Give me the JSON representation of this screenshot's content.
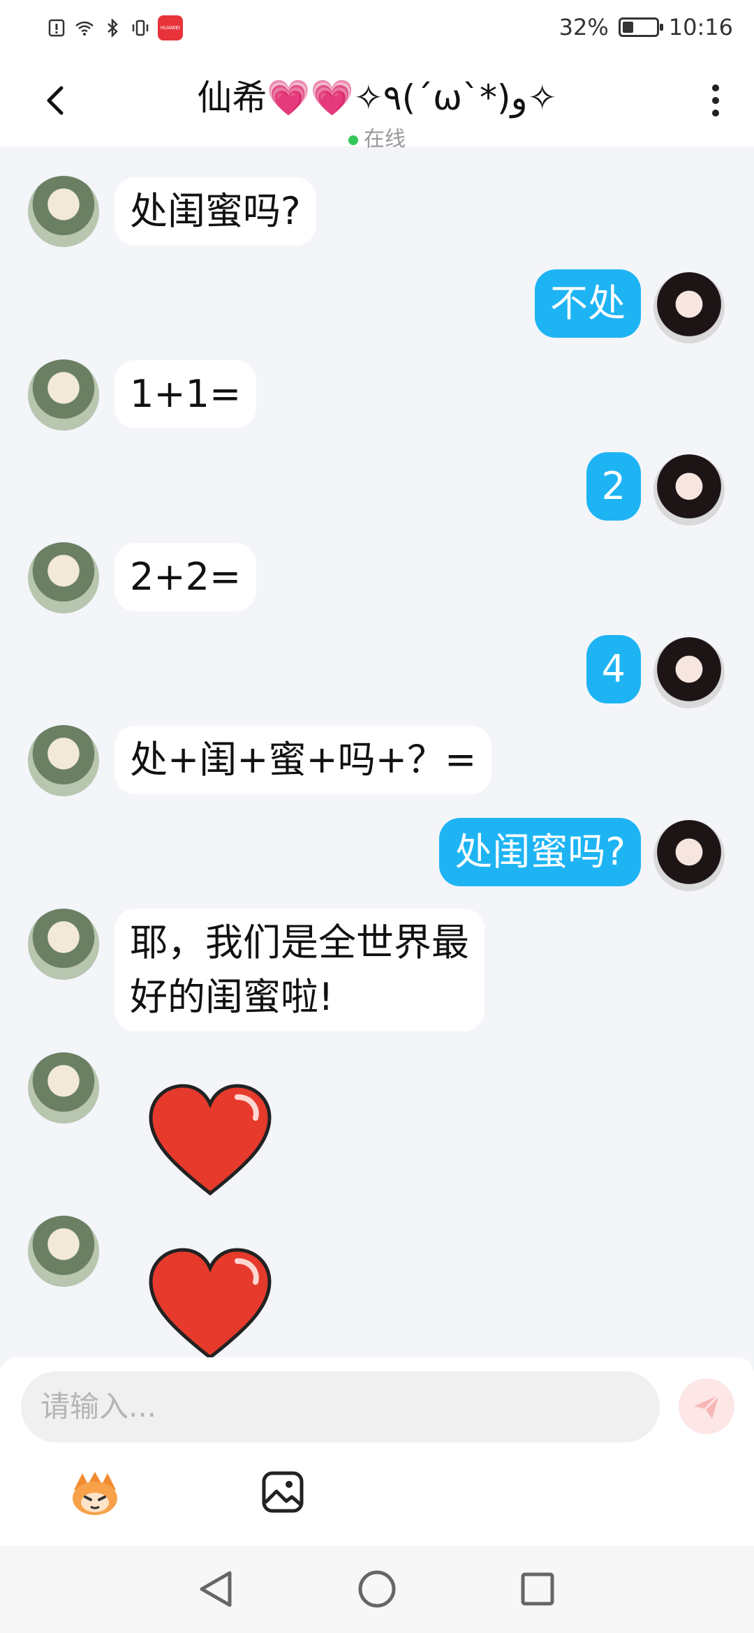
{
  "status_bar": {
    "battery": "32%",
    "battery_level": 0.32,
    "time": "10:16",
    "brand_badge": "HUAWEI"
  },
  "header": {
    "title": "仙希💗💗✧٩(ˊωˋ*)و✧",
    "status": "在线"
  },
  "messages": [
    {
      "side": "left",
      "type": "text",
      "text": "处闺蜜吗?"
    },
    {
      "side": "right",
      "type": "text",
      "text": "不处"
    },
    {
      "side": "left",
      "type": "text",
      "text": "1+1="
    },
    {
      "side": "right",
      "type": "text",
      "text": "2"
    },
    {
      "side": "left",
      "type": "text",
      "text": "2+2="
    },
    {
      "side": "right",
      "type": "text",
      "text": "4"
    },
    {
      "side": "left",
      "type": "text",
      "text": "处+闺+蜜+吗+？="
    },
    {
      "side": "right",
      "type": "text",
      "text": "处闺蜜吗?"
    },
    {
      "side": "left",
      "type": "text",
      "line1": "耶，我们是全世界最",
      "line2": "好的闺蜜啦!"
    },
    {
      "side": "left",
      "type": "sticker",
      "sticker": "red-heart"
    },
    {
      "side": "left",
      "type": "sticker",
      "sticker": "red-heart"
    }
  ],
  "input": {
    "placeholder": "请输入..."
  },
  "toolbar": {
    "emoji_icon": "emoji-face-icon",
    "image_icon": "image-icon",
    "send_icon": "send-icon"
  },
  "colors": {
    "accent": "#1eb4f4",
    "background": "#f3f5f9",
    "heart": "#e8333a"
  }
}
